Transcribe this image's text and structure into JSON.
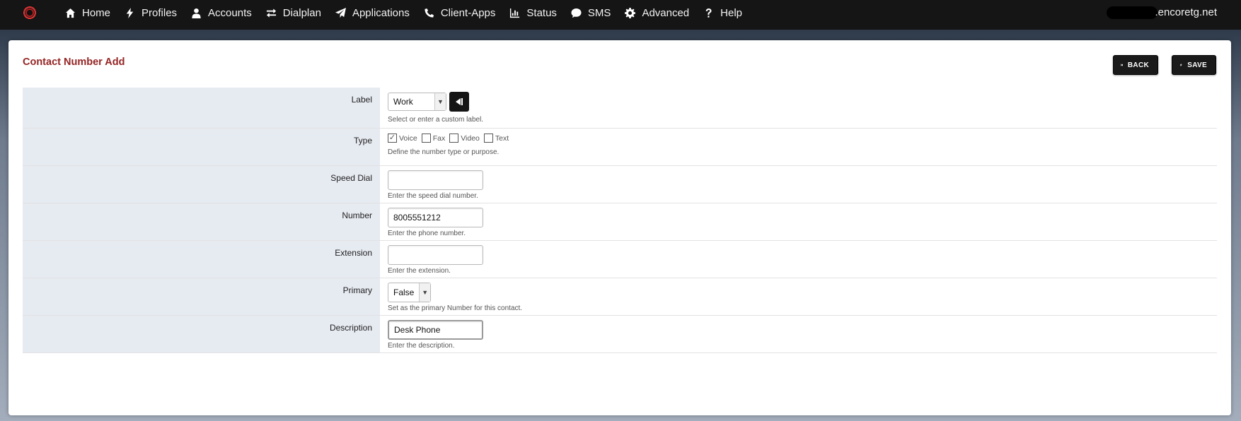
{
  "nav": {
    "items": [
      {
        "label": "Home",
        "icon": "home-icon"
      },
      {
        "label": "Profiles",
        "icon": "bolt-icon"
      },
      {
        "label": "Accounts",
        "icon": "user-icon"
      },
      {
        "label": "Dialplan",
        "icon": "exchange-icon"
      },
      {
        "label": "Applications",
        "icon": "paper-plane-icon"
      },
      {
        "label": "Client-Apps",
        "icon": "phone-icon"
      },
      {
        "label": "Status",
        "icon": "bar-chart-icon"
      },
      {
        "label": "SMS",
        "icon": "chat-icon"
      },
      {
        "label": "Advanced",
        "icon": "gear-icon"
      },
      {
        "label": "Help",
        "icon": "question-icon"
      }
    ],
    "domain": ".encoretg.net"
  },
  "page": {
    "title": "Contact Number Add",
    "back_label": "BACK",
    "save_label": "SAVE"
  },
  "form": {
    "label": {
      "name": "Label",
      "value": "Work",
      "desc": "Select or enter a custom label."
    },
    "type": {
      "name": "Type",
      "options": [
        {
          "label": "Voice",
          "checked": true
        },
        {
          "label": "Fax",
          "checked": false
        },
        {
          "label": "Video",
          "checked": false
        },
        {
          "label": "Text",
          "checked": false
        }
      ],
      "desc": "Define the number type or purpose."
    },
    "speed_dial": {
      "name": "Speed Dial",
      "value": "",
      "desc": "Enter the speed dial number."
    },
    "number": {
      "name": "Number",
      "value": "8005551212",
      "desc": "Enter the phone number."
    },
    "extension": {
      "name": "Extension",
      "value": "",
      "desc": "Enter the extension."
    },
    "primary": {
      "name": "Primary",
      "value": "False",
      "desc": "Set as the primary Number for this contact."
    },
    "description": {
      "name": "Description",
      "value": "Desk Phone",
      "desc": "Enter the description."
    }
  },
  "colors": {
    "navbar_bg": "#151515",
    "title": "#952424",
    "label_cell_bg": "#e6eaf1"
  }
}
